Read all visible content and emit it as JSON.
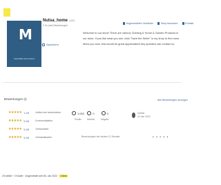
{
  "shop": {
    "name": "Nutsa_home",
    "flag": "(100)",
    "subtitle": "0 Zu jobs Bewertungen",
    "contact_label": "Speichern",
    "logo_mark": "M",
    "logo_text": "Casa Ella Home Decor"
  },
  "top_links": [
    {
      "label": "Angemeldeten Verkäufer"
    },
    {
      "label": "Shop besuchen"
    },
    {
      "label": "Kontakt"
    }
  ],
  "welcome_text": "Welcome to our store! There are various Clothing & Home & Garden Products in our store. If you like what you see, click \"Save the Seller\" in my shop to find more items you love, that would be great appreciated! Any question can contact us.",
  "feedback": {
    "title": "Bewertungen (I)",
    "all_link": "Alle Bewertungen anzeigen",
    "ratings": [
      {
        "stars": "★★★★★",
        "count": "1.03",
        "label": "Artikel wie beschrieben"
      },
      {
        "stars": "★★★★★",
        "count": "5.00",
        "label": "Kommunikation"
      },
      {
        "stars": "★★★★★",
        "count": "5.00",
        "label": "Versandzeit"
      },
      {
        "stars": "★★★★★",
        "count": "5.00",
        "label": "Versandkosten"
      }
    ],
    "stats": [
      {
        "value": "1,002",
        "label": "Positiv"
      },
      {
        "value": "0",
        "label": "Neutral"
      },
      {
        "value": "0",
        "label": "Negativ"
      }
    ],
    "last": {
      "label": "Zuletzt",
      "date": "24 Jan 2022"
    },
    "mid_note": "Bewertungen der letzten 12 Monate",
    "dots": "• • • • •"
  },
  "footer": {
    "text": "29 Artikel · 0 Käufer · Angemeldet seit 06. Jan 2022 ·",
    "highlight": "Online"
  }
}
